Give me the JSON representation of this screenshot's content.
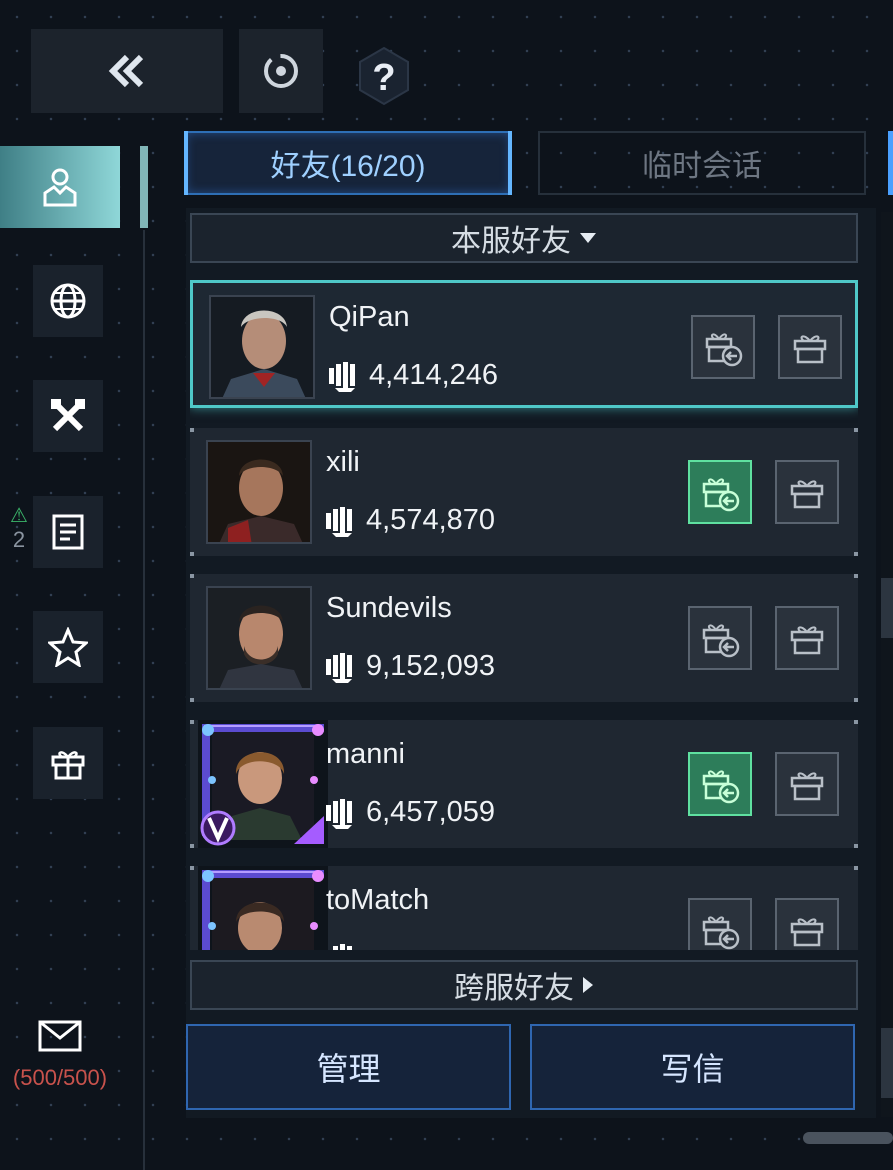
{
  "tabs": {
    "friends": "好友(16/20)",
    "temp_chat": "临时会话"
  },
  "sections": {
    "local": "本服好友",
    "cross": "跨服好友"
  },
  "friends": [
    {
      "name": "QiPan",
      "power": "4,414,246",
      "vip": false,
      "gift_available": false
    },
    {
      "name": "xili",
      "power": "4,574,870",
      "vip": false,
      "gift_available": true
    },
    {
      "name": "Sundevils",
      "power": "9,152,093",
      "vip": false,
      "gift_available": false
    },
    {
      "name": "manni",
      "power": "6,457,059",
      "vip": true,
      "gift_available": true
    },
    {
      "name": "toMatch",
      "power": "",
      "vip": true,
      "gift_available": false
    }
  ],
  "sidebar": {
    "alert_count": "2",
    "mail_count": "(500/500)"
  },
  "buttons": {
    "manage": "管理",
    "write": "写信"
  },
  "icons": {
    "back": "double-chevron-left-icon",
    "cycle": "cycle-icon",
    "help": "question-icon",
    "mail": "envelope-icon"
  },
  "colors": {
    "accent_teal": "#4fc8c8",
    "accent_blue": "#2e6fb6",
    "gift_active": "#2d7d5a",
    "mail_count": "#c8524c"
  }
}
